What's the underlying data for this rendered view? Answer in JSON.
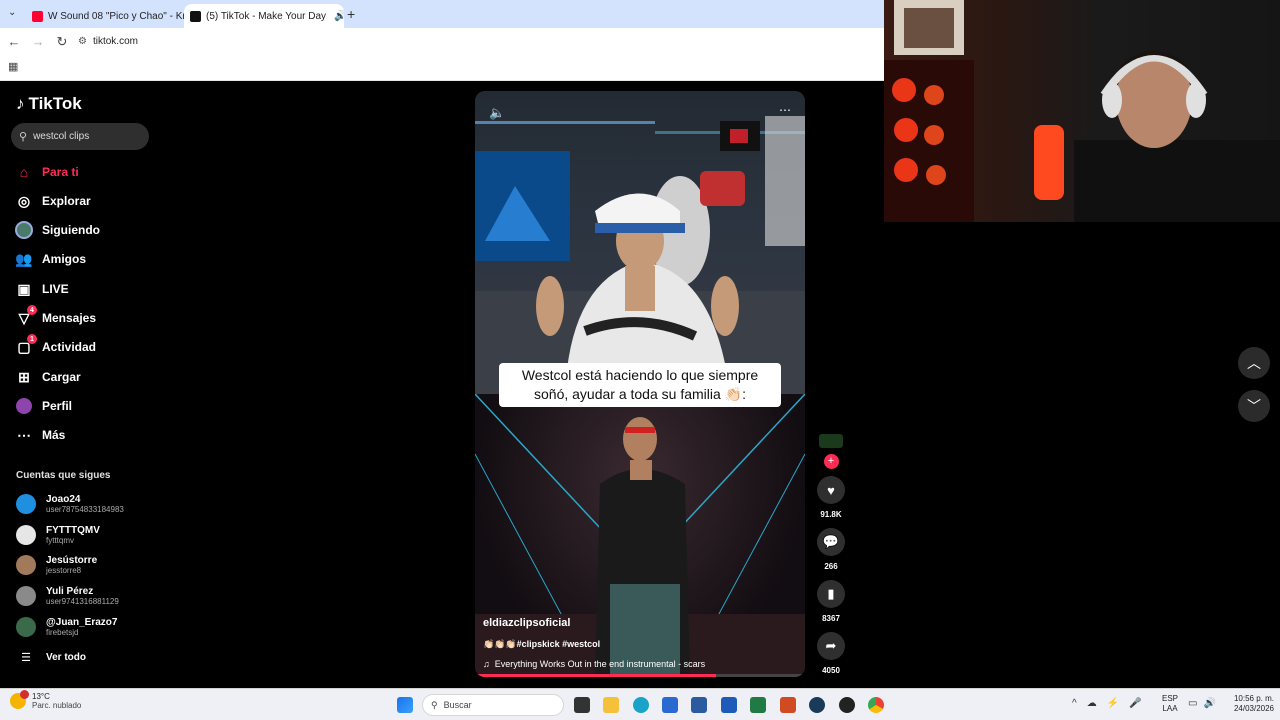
{
  "browser": {
    "tabs": [
      {
        "title": "W Sound 08 \"Pico y Chao\" - Kr",
        "active": false,
        "color": "#ff0033"
      },
      {
        "title": "(5) TikTok - Make Your Day",
        "active": true,
        "color": "#111111"
      }
    ],
    "url": "tiktok.com"
  },
  "sidebar": {
    "logo": "TikTok",
    "search_value": "westcol clips",
    "nav": [
      {
        "label": "Para ti",
        "icon": "home-icon",
        "active": true
      },
      {
        "label": "Explorar",
        "icon": "compass-icon"
      },
      {
        "label": "Siguiendo",
        "icon": "following-avatar-icon"
      },
      {
        "label": "Amigos",
        "icon": "friends-icon"
      },
      {
        "label": "LIVE",
        "icon": "live-icon"
      },
      {
        "label": "Mensajes",
        "icon": "messages-icon",
        "badge": "4"
      },
      {
        "label": "Actividad",
        "icon": "activity-icon",
        "badge": "1"
      },
      {
        "label": "Cargar",
        "icon": "upload-icon"
      },
      {
        "label": "Perfil",
        "icon": "profile-icon"
      },
      {
        "label": "Más",
        "icon": "more-icon"
      }
    ],
    "following_title": "Cuentas que sigues",
    "accounts": [
      {
        "name": "Joao24",
        "handle": "user78754833184983",
        "color": "#1f8fe0"
      },
      {
        "name": "FYTTTQMV",
        "handle": "fytttqmv",
        "color": "#e6e6e6"
      },
      {
        "name": "Jesústorre",
        "handle": "jesstorre8",
        "color": "#a07a5a"
      },
      {
        "name": "Yuli Pérez",
        "handle": "user9741316881129",
        "color": "#8a8a8a"
      },
      {
        "name": "@Juan_Erazo7",
        "handle": "firebetsjd",
        "color": "#3a6a4a"
      }
    ],
    "see_all": "Ver todo"
  },
  "video": {
    "caption_overlay": "Westcol está haciendo lo que siempre soñó, ayudar a toda su familia 👏🏻:",
    "author": "eldiazclipsoficial",
    "tags": "👏🏻👏🏻👏🏻#clipskick #westcol",
    "music": "Everything Works Out in the end instrumental - scars",
    "progress": 0.73
  },
  "actions": {
    "likes": "91.8K",
    "comments": "266",
    "saves": "8367",
    "shares": "4050"
  },
  "taskbar": {
    "weather_temp": "13°C",
    "weather_desc": "Parc. nublado",
    "search_placeholder": "Buscar",
    "lang": "ESP",
    "lang_sub": "LAA",
    "time": "10:56 p. m.",
    "date": "24/03/2026"
  },
  "colors": {
    "accent": "#fe2c55"
  }
}
